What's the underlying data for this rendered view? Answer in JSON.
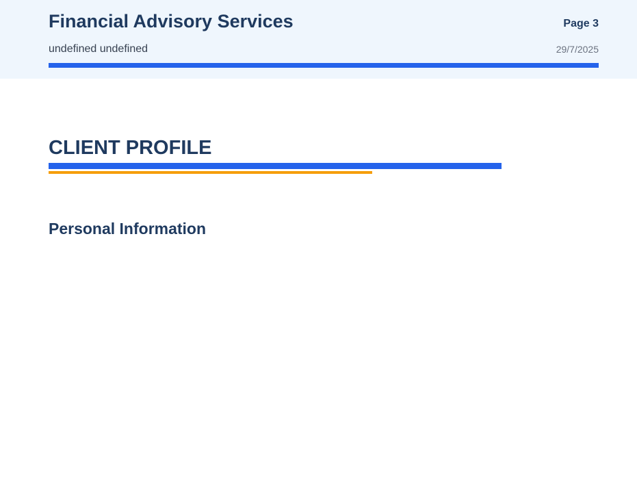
{
  "header": {
    "company_name": "Financial Advisory Services",
    "client_name": "undefined undefined",
    "page_label": "Page 3",
    "date": "29/7/2025"
  },
  "section": {
    "title": "CLIENT PROFILE",
    "subsection_title": "Personal Information"
  },
  "colors": {
    "header_background": "#eff6fd",
    "primary_navy": "#1f3a5f",
    "accent_blue": "#2563eb",
    "accent_orange": "#f59e0b"
  }
}
